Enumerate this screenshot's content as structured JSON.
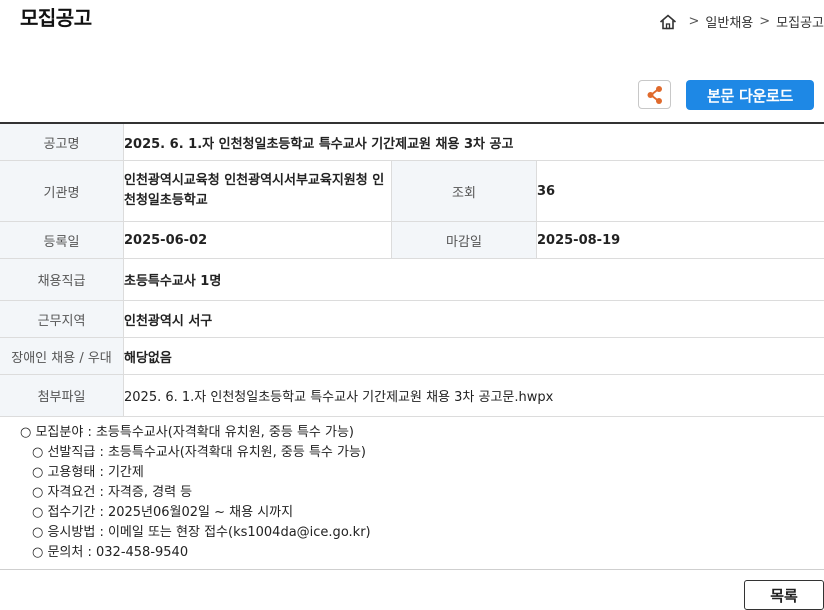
{
  "page": {
    "title": "모집공고"
  },
  "breadcrumb": {
    "items": [
      "일반채용",
      "모집공고"
    ],
    "separator": ">",
    "home_icon": "home-icon"
  },
  "actions": {
    "share_icon": "share-icon",
    "download_label": "본문 다운로드",
    "accent_color": "#1e88e5",
    "share_icon_color": "#e06a2c"
  },
  "info": {
    "notice_name_label": "공고명",
    "notice_name": "2025. 6. 1.자 인천청일초등학교 특수교사 기간제교원 채용 3차 공고",
    "agency_label": "기관명",
    "agency": "인천광역시교육청 인천광역시서부교육지원청 인천청일초등학교",
    "views_label": "조회",
    "views": "36",
    "reg_date_label": "등록일",
    "reg_date": "2025-06-02",
    "deadline_label": "마감일",
    "deadline": "2025-08-19",
    "position_label": "채용직급",
    "position": "초등특수교사 1명",
    "region_label": "근무지역",
    "region": "인천광역시 서구",
    "disability_label": "장애인 채용 / 우대",
    "disability": "해당없음",
    "attachment_label": "첨부파일",
    "attachment": "2025. 6. 1.자 인천청일초등학교 특수교사 기간제교원 채용 3차 공고문.hwpx"
  },
  "details": {
    "lines": [
      "○ 모집분야 : 초등특수교사(자격확대 유치원, 중등 특수 가능)",
      "○ 선발직급 : 초등특수교사(자격확대 유치원, 중등 특수 가능)",
      "○ 고용형태 : 기간제",
      "○ 자격요건 : 자격증, 경력  등",
      "○ 접수기간 : 2025년06월02일 ~ 채용 시까지",
      "○ 응시방법 : 이메일 또는 현장 접수(ks1004da@ice.go.kr)",
      "○ 문의처 : 032-458-9540"
    ]
  },
  "footer": {
    "list_label": "목록"
  }
}
